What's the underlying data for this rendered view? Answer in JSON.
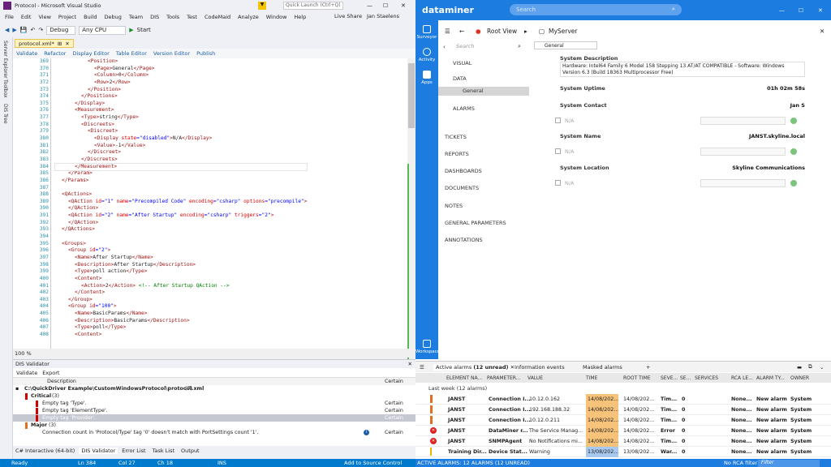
{
  "vs": {
    "title": "Protocol - Microsoft Visual Studio",
    "search_placeholder": "Quick Launch (Ctrl+Q)",
    "user": "Jan Staelens",
    "live_share": "Live Share",
    "menu": [
      "File",
      "Edit",
      "View",
      "Project",
      "Build",
      "Debug",
      "Team",
      "DIS",
      "Tools",
      "Test",
      "CodeMaid",
      "Analyze",
      "Window",
      "Help"
    ],
    "toolbar": {
      "config": "Debug",
      "platform": "Any CPU",
      "start": "Start"
    },
    "side_tabs": [
      "Server Explorer",
      "Toolbox",
      "DIS Tree"
    ],
    "doc_tab": "protocol.xml*",
    "doc_toolbar": [
      "Validate",
      "Refactor",
      "Display Editor",
      "Table Editor",
      "Version Editor",
      "Publish"
    ],
    "zoom": "100 %",
    "lines": [
      {
        "n": "369",
        "i": 5,
        "s": [
          [
            "t",
            "<Position>"
          ]
        ]
      },
      {
        "n": "370",
        "i": 6,
        "s": [
          [
            "t",
            "<Page>"
          ],
          [
            "p",
            "General"
          ],
          [
            "t",
            "</Page>"
          ]
        ]
      },
      {
        "n": "371",
        "i": 6,
        "s": [
          [
            "t",
            "<Column>"
          ],
          [
            "p",
            "0"
          ],
          [
            "t",
            "</Column>"
          ]
        ]
      },
      {
        "n": "372",
        "i": 6,
        "s": [
          [
            "t",
            "<Row>"
          ],
          [
            "p",
            "2"
          ],
          [
            "t",
            "</Row>"
          ]
        ]
      },
      {
        "n": "373",
        "i": 5,
        "s": [
          [
            "t",
            "</Position>"
          ]
        ]
      },
      {
        "n": "374",
        "i": 4,
        "s": [
          [
            "t",
            "</Positions>"
          ]
        ]
      },
      {
        "n": "375",
        "i": 3,
        "s": [
          [
            "t",
            "</Display>"
          ]
        ]
      },
      {
        "n": "376",
        "i": 3,
        "s": [
          [
            "t",
            "<Measurement>"
          ]
        ]
      },
      {
        "n": "377",
        "i": 4,
        "s": [
          [
            "t",
            "<Type>"
          ],
          [
            "p",
            "string"
          ],
          [
            "t",
            "</Type>"
          ]
        ]
      },
      {
        "n": "378",
        "i": 4,
        "s": [
          [
            "t",
            "<Discreets>"
          ]
        ]
      },
      {
        "n": "379",
        "i": 5,
        "s": [
          [
            "t",
            "<Discreet>"
          ]
        ]
      },
      {
        "n": "380",
        "i": 6,
        "s": [
          [
            "t",
            "<Display "
          ],
          [
            "a",
            "state"
          ],
          [
            "b",
            "="
          ],
          [
            "v",
            "\"disabled\""
          ],
          [
            "t",
            ">"
          ],
          [
            "p",
            "N/A"
          ],
          [
            "t",
            "</Display>"
          ]
        ]
      },
      {
        "n": "381",
        "i": 6,
        "s": [
          [
            "t",
            "<Value>"
          ],
          [
            "p",
            "-1"
          ],
          [
            "t",
            "</Value>"
          ]
        ]
      },
      {
        "n": "382",
        "i": 5,
        "s": [
          [
            "t",
            "</Discreet>"
          ]
        ]
      },
      {
        "n": "383",
        "i": 4,
        "s": [
          [
            "t",
            "</Discreets>"
          ]
        ]
      },
      {
        "n": "384",
        "i": 3,
        "s": [
          [
            "t",
            "</Measurement>"
          ]
        ]
      },
      {
        "n": "385",
        "i": 2,
        "s": [
          [
            "t",
            "</Param>"
          ]
        ]
      },
      {
        "n": "386",
        "i": 1,
        "s": [
          [
            "t",
            "</Params>"
          ]
        ]
      },
      {
        "n": "387",
        "i": 0,
        "s": []
      },
      {
        "n": "388",
        "i": 1,
        "s": [
          [
            "t",
            "<QActions>"
          ]
        ]
      },
      {
        "n": "389",
        "i": 2,
        "s": [
          [
            "t",
            "<QAction "
          ],
          [
            "a",
            "id"
          ],
          [
            "b",
            "="
          ],
          [
            "v",
            "\"1\" "
          ],
          [
            "a",
            "name"
          ],
          [
            "b",
            "="
          ],
          [
            "v",
            "\"Precompiled Code\" "
          ],
          [
            "a",
            "encoding"
          ],
          [
            "b",
            "="
          ],
          [
            "v",
            "\"csharp\" "
          ],
          [
            "a",
            "options"
          ],
          [
            "b",
            "="
          ],
          [
            "v",
            "\"precompile\""
          ],
          [
            "t",
            ">"
          ]
        ]
      },
      {
        "n": "390",
        "i": 2,
        "s": [
          [
            "t",
            "</QAction>"
          ]
        ]
      },
      {
        "n": "391",
        "i": 2,
        "s": [
          [
            "t",
            "<QAction "
          ],
          [
            "a",
            "id"
          ],
          [
            "b",
            "="
          ],
          [
            "v",
            "\"2\" "
          ],
          [
            "a",
            "name"
          ],
          [
            "b",
            "="
          ],
          [
            "v",
            "\"After Startup\" "
          ],
          [
            "a",
            "encoding"
          ],
          [
            "b",
            "="
          ],
          [
            "v",
            "\"csharp\" "
          ],
          [
            "a",
            "triggers"
          ],
          [
            "b",
            "="
          ],
          [
            "v",
            "\"2\""
          ],
          [
            "t",
            ">"
          ]
        ]
      },
      {
        "n": "392",
        "i": 2,
        "s": [
          [
            "t",
            "</QAction>"
          ]
        ]
      },
      {
        "n": "393",
        "i": 1,
        "s": [
          [
            "t",
            "</QActions>"
          ]
        ]
      },
      {
        "n": "394",
        "i": 0,
        "s": []
      },
      {
        "n": "395",
        "i": 1,
        "s": [
          [
            "t",
            "<Groups>"
          ]
        ]
      },
      {
        "n": "396",
        "i": 2,
        "s": [
          [
            "t",
            "<Group "
          ],
          [
            "a",
            "id"
          ],
          [
            "b",
            "="
          ],
          [
            "v",
            "\"2\""
          ],
          [
            "t",
            ">"
          ]
        ]
      },
      {
        "n": "397",
        "i": 3,
        "s": [
          [
            "t",
            "<Name>"
          ],
          [
            "p",
            "After Startup"
          ],
          [
            "t",
            "</Name>"
          ]
        ]
      },
      {
        "n": "398",
        "i": 3,
        "s": [
          [
            "t",
            "<Description>"
          ],
          [
            "p",
            "After Startup"
          ],
          [
            "t",
            "</Description>"
          ]
        ]
      },
      {
        "n": "399",
        "i": 3,
        "s": [
          [
            "t",
            "<Type>"
          ],
          [
            "p",
            "poll action"
          ],
          [
            "t",
            "</Type>"
          ]
        ]
      },
      {
        "n": "400",
        "i": 3,
        "s": [
          [
            "t",
            "<Content>"
          ]
        ]
      },
      {
        "n": "401",
        "i": 4,
        "s": [
          [
            "t",
            "<Action>"
          ],
          [
            "p",
            "2"
          ],
          [
            "t",
            "</Action>"
          ],
          [
            "c",
            " <!-- After Startup QAction -->"
          ]
        ]
      },
      {
        "n": "402",
        "i": 3,
        "s": [
          [
            "t",
            "</Content>"
          ]
        ]
      },
      {
        "n": "403",
        "i": 2,
        "s": [
          [
            "t",
            "</Group>"
          ]
        ]
      },
      {
        "n": "404",
        "i": 2,
        "s": [
          [
            "t",
            "<Group "
          ],
          [
            "a",
            "id"
          ],
          [
            "b",
            "="
          ],
          [
            "v",
            "\"100\""
          ],
          [
            "t",
            ">"
          ]
        ]
      },
      {
        "n": "405",
        "i": 3,
        "s": [
          [
            "t",
            "<Name>"
          ],
          [
            "p",
            "BasicParams"
          ],
          [
            "t",
            "</Name>"
          ]
        ]
      },
      {
        "n": "406",
        "i": 3,
        "s": [
          [
            "t",
            "<Description>"
          ],
          [
            "p",
            "BasicParams"
          ],
          [
            "t",
            "</Description>"
          ]
        ]
      },
      {
        "n": "407",
        "i": 3,
        "s": [
          [
            "t",
            "<Type>"
          ],
          [
            "p",
            "poll"
          ],
          [
            "t",
            "</Type>"
          ]
        ]
      },
      {
        "n": "408",
        "i": 3,
        "s": [
          [
            "t",
            "<Content>"
          ]
        ]
      }
    ],
    "validator": {
      "title": "DIS Validator",
      "toolbar": [
        "Validate",
        "Export"
      ],
      "col_description": "Description",
      "col_certainty": "Certain",
      "path": "C:\\QuickDriver Example\\CustomWindowsProtocol\\protocol.xml",
      "path_count": "(7)",
      "critical": "Critical",
      "critical_count": "(3)",
      "items": [
        {
          "text": "Empty tag 'Type'.",
          "cert": "Certain"
        },
        {
          "text": "Empty tag 'ElementType'.",
          "cert": "Certain"
        },
        {
          "text": "Empty tag 'Provider'.",
          "cert": "Certain"
        }
      ],
      "major": "Major",
      "major_count": "(3)",
      "major_item": "Connection count in 'Protocol/Type' tag '0' doesn't match with PortSettings count '1'.",
      "major_cert": "Certain"
    },
    "bottom_tabs": [
      "C# Interactive (64-bit)",
      "DIS Validator",
      "Error List",
      "Task List",
      "Output"
    ],
    "status": {
      "ready": "Ready",
      "ln": "Ln 384",
      "col": "Col 27",
      "ch": "Ch 18",
      "ins": "INS",
      "source": "Add to Source Control"
    }
  },
  "dm": {
    "logo": "dataminer",
    "search_placeholder": "Search",
    "nav": [
      {
        "label": "Surveyor",
        "icon": "surveyor-icon"
      },
      {
        "label": "Activity",
        "icon": "activity-icon"
      },
      {
        "label": "Apps",
        "icon": "apps-icon"
      }
    ],
    "workspace": "Workspace",
    "root_view": "Root View",
    "server": "MyServer",
    "side_search": "Search",
    "menu": [
      "VISUAL",
      "DATA",
      "General",
      "ALARMS",
      "TICKETS",
      "REPORTS",
      "DASHBOARDS",
      "DOCUMENTS",
      "NOTES",
      "GENERAL PARAMETERS",
      "ANNOTATIONS"
    ],
    "page_select": "General",
    "fields": {
      "desc_label": "System Description",
      "desc_value": "Hardware: Intel64 Family 6 Model 158 Stepping 13 AT/AT COMPATIBLE - Software: Windows Version 6.3 (Build 18363 Multiprocessor Free)",
      "uptime_label": "System Uptime",
      "uptime_value": "01h 02m 58s",
      "contact_label": "System Contact",
      "contact_value": "Jan S",
      "name_label": "System Name",
      "name_value": "JANST.skyline.local",
      "location_label": "System Location",
      "location_value": "Skyline Communications",
      "na": "N/A"
    },
    "alarm_tabs": {
      "active": "Active alarms",
      "active_count": "(12 unread)",
      "info": "Information events",
      "masked": "Masked alarms"
    },
    "alarm_cols": [
      "ELEMENT NA...",
      "PARAMETER...",
      "VALUE",
      "TIME",
      "ROOT TIME",
      "SEVE...",
      "SE...",
      "SERVICES",
      "RCA LE...",
      "ALARM TY...",
      "OWNER"
    ],
    "alarm_group": "Last week (12 alarms)",
    "alarms": [
      {
        "sev": "",
        "el": "JANST",
        "par": "Connection I...",
        "val": "10.12.0.162",
        "time": "14/08/202...",
        "root": "14/08/202...",
        "s1": "Tim...",
        "s2": "0",
        "rca": "None...",
        "type": "New alarm",
        "owner": "System",
        "tc": "#f7c27a"
      },
      {
        "sev": "",
        "el": "JANST",
        "par": "Connection I...",
        "val": "192.168.188.32",
        "time": "14/08/202...",
        "root": "14/08/202...",
        "s1": "Tim...",
        "s2": "0",
        "rca": "None...",
        "type": "New alarm",
        "owner": "System",
        "tc": "#f7c27a"
      },
      {
        "sev": "",
        "el": "JANST",
        "par": "Connection I...",
        "val": "10.12.0.211",
        "time": "14/08/202...",
        "root": "14/08/202...",
        "s1": "Tim...",
        "s2": "0",
        "rca": "None...",
        "type": "New alarm",
        "owner": "System",
        "tc": "#f7c27a"
      },
      {
        "sev": "error",
        "el": "JANST",
        "par": "DataMiner r...",
        "val": "The Service Manag...",
        "time": "14/08/202...",
        "root": "14/08/202...",
        "s1": "Error",
        "s2": "0",
        "rca": "None...",
        "type": "New alarm",
        "owner": "System",
        "tc": "#f7c27a"
      },
      {
        "sev": "error",
        "el": "JANST",
        "par": "SNMPAgent",
        "val": "No Notifications mi...",
        "time": "14/08/202...",
        "root": "14/08/202...",
        "s1": "Tim...",
        "s2": "0",
        "rca": "None...",
        "type": "New alarm",
        "owner": "System",
        "tc": "#f7c27a"
      },
      {
        "sev": "warn",
        "el": "Training Dir...",
        "par": "Device Stat...",
        "val": "Warning",
        "time": "13/08/202...",
        "root": "13/08/202...",
        "s1": "War...",
        "s2": "0",
        "rca": "None...",
        "type": "New alarm",
        "owner": "System",
        "tc": "#a9c8ef"
      }
    ],
    "status_text": "ACTIVE ALARMS: 12 ALARMS (12 UNREAD)",
    "rca": "No RCA filter",
    "filter": "Filter"
  }
}
